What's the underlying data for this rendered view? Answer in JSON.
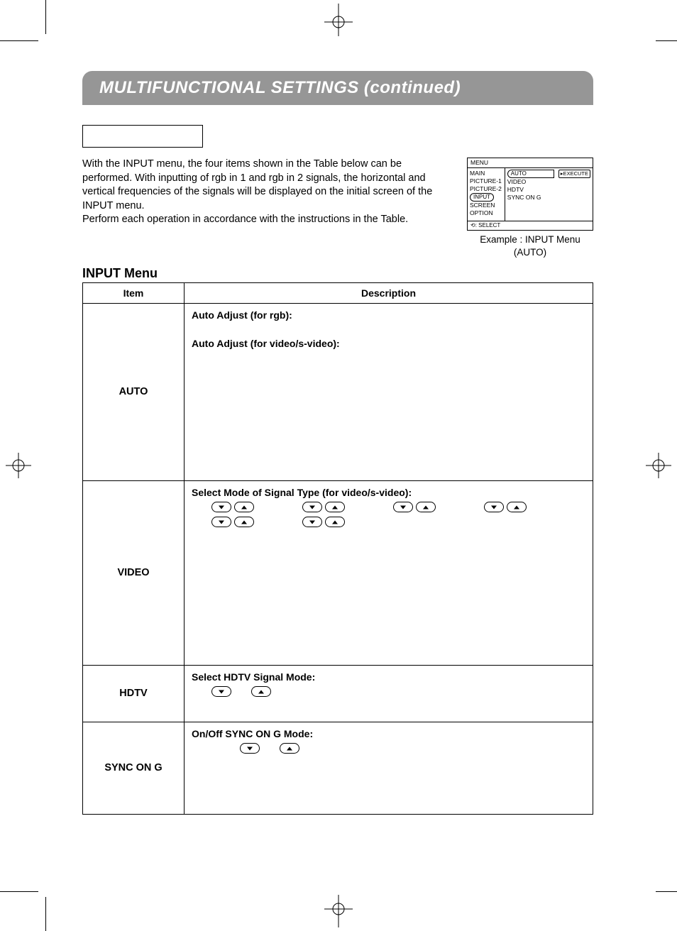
{
  "title": "MULTIFUNCTIONAL SETTINGS (continued)",
  "description": {
    "p1": "With the INPUT menu, the four items shown in the Table below can be performed. With inputting of rgb in 1 and rgb in 2 signals, the horizontal and vertical frequencies of the signals will be displayed on the initial screen of the INPUT menu.",
    "p2": "Perform each operation in accordance with the instructions in the Table."
  },
  "osd": {
    "header": "MENU",
    "left_items": [
      "MAIN",
      "PICTURE-1",
      "PICTURE-2",
      "INPUT",
      "SCREEN",
      "OPTION"
    ],
    "left_selected_index": 3,
    "mid_items": [
      "AUTO",
      "VIDEO",
      "HDTV",
      "SYNC ON G"
    ],
    "mid_selected_index": 0,
    "right_label": "▸EXECUTE",
    "footer": "⟲: SELECT"
  },
  "menu_caption_line1": "Example : INPUT Menu",
  "menu_caption_line2": "(AUTO)",
  "section_title": "INPUT Menu",
  "table": {
    "headers": {
      "item": "Item",
      "desc": "Description"
    },
    "rows": [
      {
        "item": "AUTO",
        "desc1": "Auto Adjust (for rgb):",
        "desc2": "Auto Adjust (for video/s-video):"
      },
      {
        "item": "VIDEO",
        "desc1": "Select Mode of Signal Type (for video/s-video):"
      },
      {
        "item": "HDTV",
        "desc1": "Select HDTV Signal Mode:"
      },
      {
        "item": "SYNC ON G",
        "desc1": "On/Off SYNC ON G Mode:"
      }
    ]
  }
}
